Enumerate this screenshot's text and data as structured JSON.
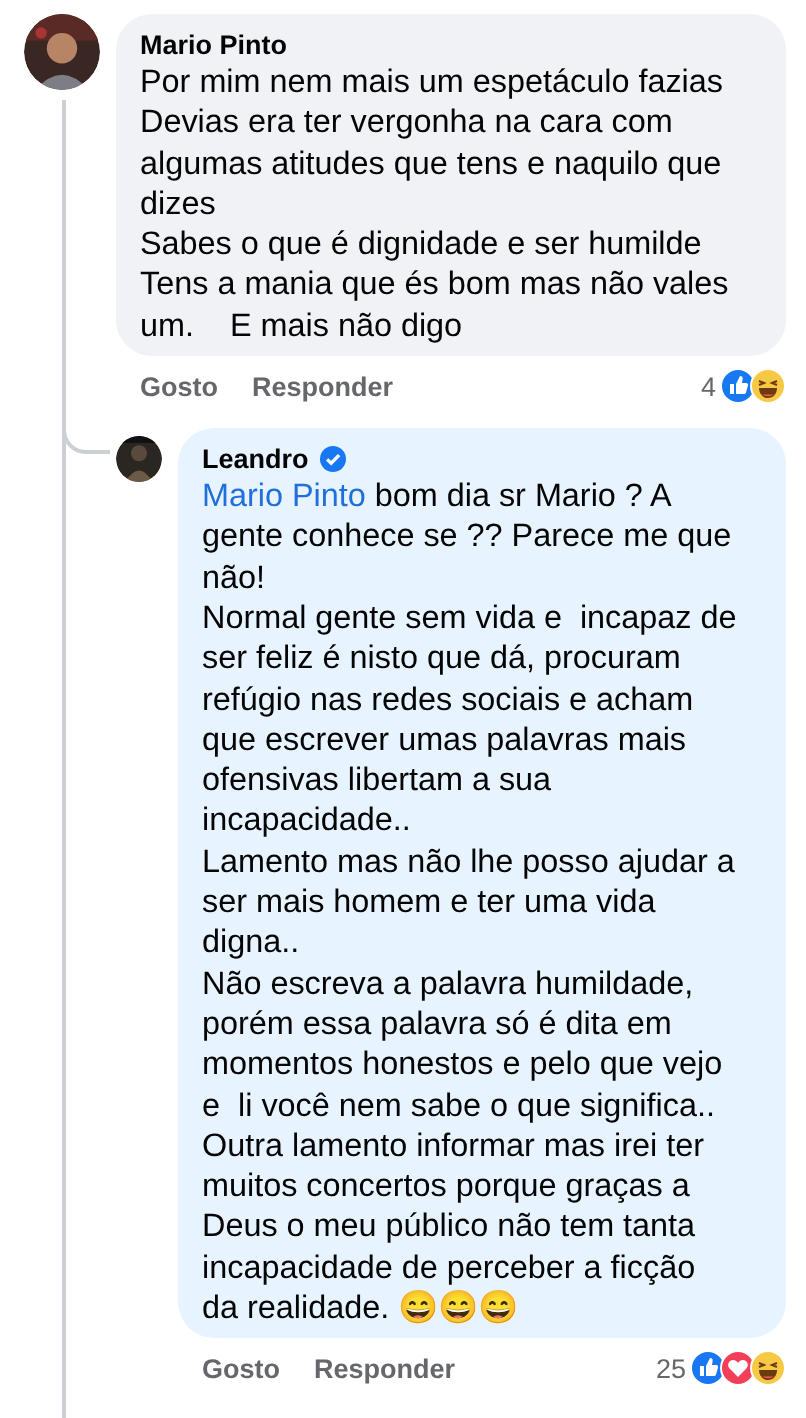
{
  "comments": [
    {
      "author": "Mario Pinto",
      "verified": false,
      "reply": false,
      "body": {
        "text": "Por mim nem mais um espetáculo fazias\nDevias era ter vergonha na cara com\nalgumas atitudes que tens e naquilo que\ndizes\nSabes o que é dignidade e ser humilde\nTens a mania que és bom mas não vales\num.    E mais não digo"
      },
      "actions": [
        "Gosto",
        "Responder"
      ],
      "reaction_count": "4",
      "reactions": [
        {
          "kind": "like"
        },
        {
          "kind": "haha"
        }
      ]
    },
    {
      "author": "Leandro",
      "verified": true,
      "reply": true,
      "body": {
        "mention": "Mario Pinto",
        "text": " bom dia sr Mario ? A\ngente conhece se ?? Parece me que\nnão!\nNormal gente sem vida e  incapaz de\nser feliz é nisto que dá, procuram\nrefúgio nas redes sociais e acham\nque escrever umas palavras mais\nofensivas libertam a sua\nincapacidade..\nLamento mas não lhe posso ajudar a\nser mais homem e ter uma vida\ndigna..\nNão escreva a palavra humildade,\nporém essa palavra só é dita em\nmomentos honestos e pelo que vejo\ne  li você nem sabe o que significa..\nOutra lamento informar mas irei ter\nmuitos concertos porque graças a\nDeus o meu público não tem tanta\nincapacidade de perceber a ficção\nda realidade. 😄😄😄"
      },
      "actions": [
        "Gosto",
        "Responder"
      ],
      "reaction_count": "25",
      "reactions": [
        {
          "kind": "like"
        },
        {
          "kind": "love"
        },
        {
          "kind": "haha"
        }
      ]
    }
  ]
}
